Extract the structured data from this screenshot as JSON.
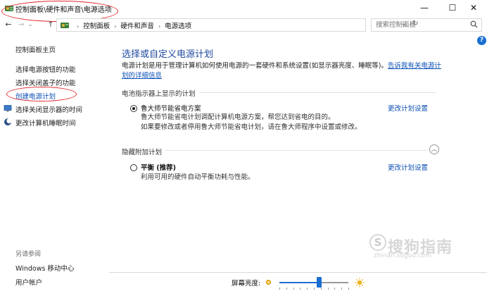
{
  "window": {
    "title": "控制面板\\硬件和声音\\电源选项",
    "minimize_glyph": "—",
    "maximize_glyph": "☐",
    "close_glyph": "✕"
  },
  "addressbar": {
    "breadcrumb": [
      "控制面板",
      "硬件和声音",
      "电源选项"
    ],
    "search_placeholder": "搜索控制面板"
  },
  "sidebar": {
    "items": [
      {
        "label": "控制面板主页"
      },
      {
        "label": "选择电源按钮的功能"
      },
      {
        "label": "选择关闭盖子的功能"
      },
      {
        "label": "创建电源计划"
      },
      {
        "label": "选择关闭显示器的时间"
      },
      {
        "label": "更改计算机睡眠时间"
      }
    ],
    "see_also": "另请参阅",
    "see_also_items": [
      {
        "label": "Windows 移动中心"
      },
      {
        "label": "用户帐户"
      }
    ]
  },
  "main": {
    "title": "选择或自定义电源计划",
    "description": "电源计划是用于管理计算机如何使用电源的一套硬件和系统设置(如显示器亮度、睡眠等)。",
    "description_link": "告诉我有关电源计划的详细信息",
    "shown_section": "电池指示器上显示的计划",
    "plan1": {
      "name": "鲁大师节能省电方案",
      "desc1": "鲁大师节能省电计划调配计算机电源方案，帮您达到省电的目的。",
      "desc2": "如果要修改或者停用鲁大师节能省电计划，请在鲁大师程序中设置或修改。",
      "change": "更改计划设置",
      "selected": true
    },
    "hidden_section": "隐藏附加计划",
    "plan2": {
      "name": "平衡 (推荐)",
      "desc": "利用可用的硬件自动平衡功耗与性能。",
      "change": "更改计划设置",
      "selected": false
    }
  },
  "brightness": {
    "label": "屏幕亮度:",
    "level_fraction": 0.58
  },
  "watermark": {
    "text": "搜狗指南",
    "url": "zhinan.sogou.com",
    "logo": "S"
  },
  "colors": {
    "link": "#0b4fb5",
    "title": "#1f4aa0",
    "accent": "#1a6fd1",
    "annotation": "#e0282d"
  }
}
